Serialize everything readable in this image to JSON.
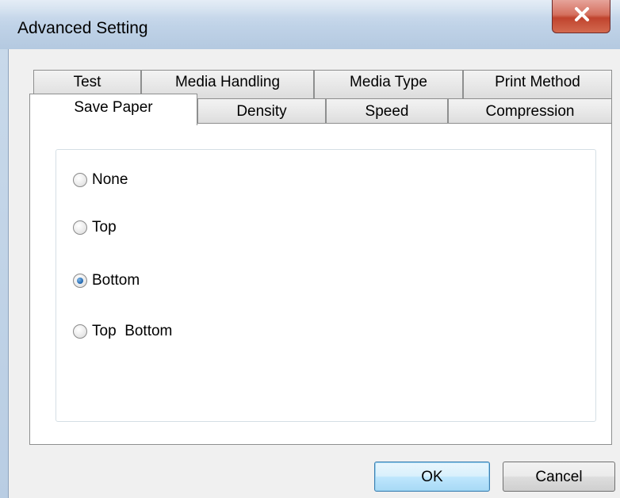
{
  "window": {
    "title": "Advanced Setting",
    "close_symbol": "x"
  },
  "tabs": {
    "row_back": [
      {
        "label": "Test"
      },
      {
        "label": "Media Handling"
      },
      {
        "label": "Media Type"
      },
      {
        "label": "Print Method"
      }
    ],
    "row_front": [
      {
        "label": "Save Paper",
        "active": true
      },
      {
        "label": "Density"
      },
      {
        "label": "Speed"
      },
      {
        "label": "Compression"
      }
    ]
  },
  "save_paper": {
    "options": [
      {
        "label": "None",
        "checked": false
      },
      {
        "label": "Top",
        "checked": false
      },
      {
        "label": "Bottom",
        "checked": true
      },
      {
        "label": "Top  Bottom",
        "checked": false
      }
    ]
  },
  "buttons": {
    "ok_label": "OK",
    "cancel_label": "Cancel"
  },
  "colors": {
    "accent": "#2a6fb6",
    "close_button": "#c0432e",
    "window_frame": "#b9cde3"
  }
}
